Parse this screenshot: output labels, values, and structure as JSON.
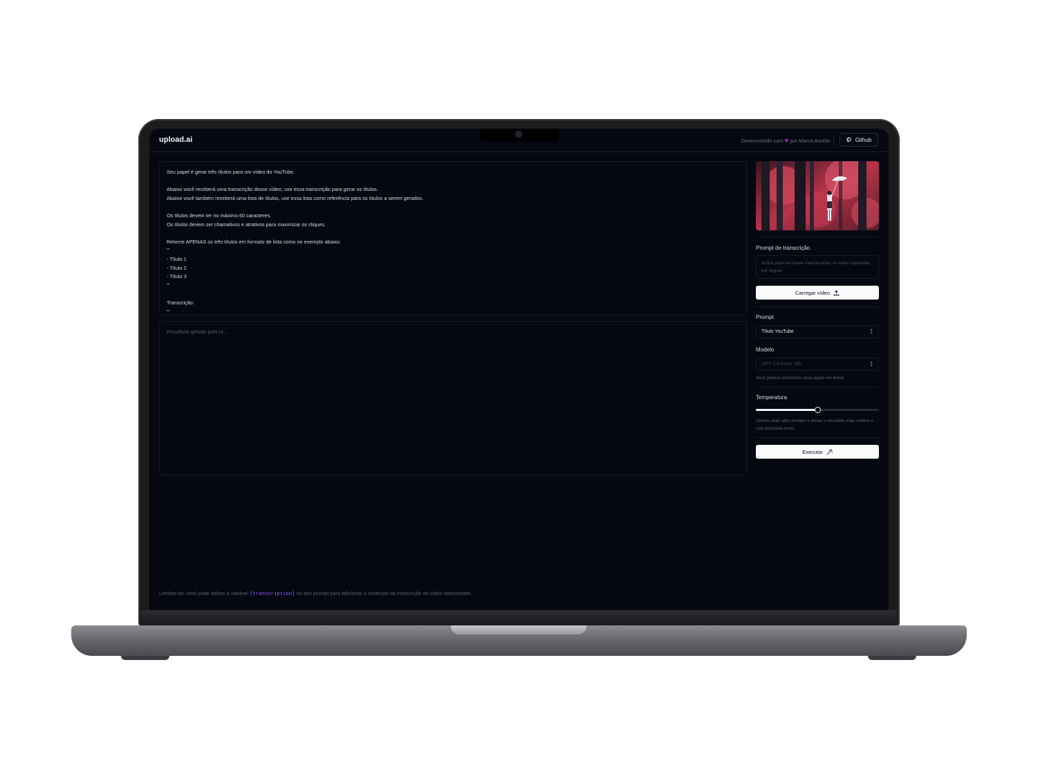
{
  "app": {
    "title": "upload.ai",
    "credit_prefix": "Desenvolvido com",
    "credit_suffix": "por Marco Aurélio",
    "github_label": "Github"
  },
  "editor": {
    "prompt_text": "Seu papel é gerar três títulos para um vídeo do YouTube.\n\nAbaixo você receberá uma transcrição desse vídeo, use essa transcrição para gerar os títulos.\nAbaixo você também receberá uma lista de títulos, use essa lista como referência para os títulos a serem gerados.\n\nOs títulos devem ter no máximo 60 caracteres.\nOs títulos devem ser chamativos e atrativos para maximizar os cliques.\n\nRetorne APENAS os três títulos em formato de lista como no exemplo abaixo:\n'''\n- Título 1\n- Título 2\n- Título 3\n'''\n\nTranscrição:\n'''",
    "result_placeholder": "Resultado gerado pela IA...",
    "footnote_prefix": "Lembre-se: você pode utilizar a variável",
    "footnote_code": "{transcription}",
    "footnote_suffix": "no seu prompt para adicionar o conteúdo da transcrição do vídeo selecionado."
  },
  "sidebar": {
    "transcription_prompt_label": "Prompt de transcrição",
    "transcription_prompt_placeholder": "Inclua palavras-chave mencionadas no vídeo separadas por vírgula",
    "upload_button": "Carregar vídeo",
    "prompt_label": "Prompt",
    "prompt_selected": "Título YouTube",
    "model_label": "Modelo",
    "model_selected": "GPT 3.5-turbo 16k",
    "model_hint": "Você poderá customizar essa opção em breve",
    "temperature_label": "Temperatura",
    "temperature_value": 0.5,
    "temperature_hint": "Valores mais altos tendem a deixar o resultado mais criativo e com possíveis erros.",
    "execute_button": "Executar"
  },
  "colors": {
    "background": "#050811",
    "accent_heart": "#c026d3",
    "code_accent": "#8b5cf6"
  },
  "icons": [
    "heart-icon",
    "github-icon",
    "upload-icon",
    "wand-icon",
    "chevron-updown-icon"
  ]
}
